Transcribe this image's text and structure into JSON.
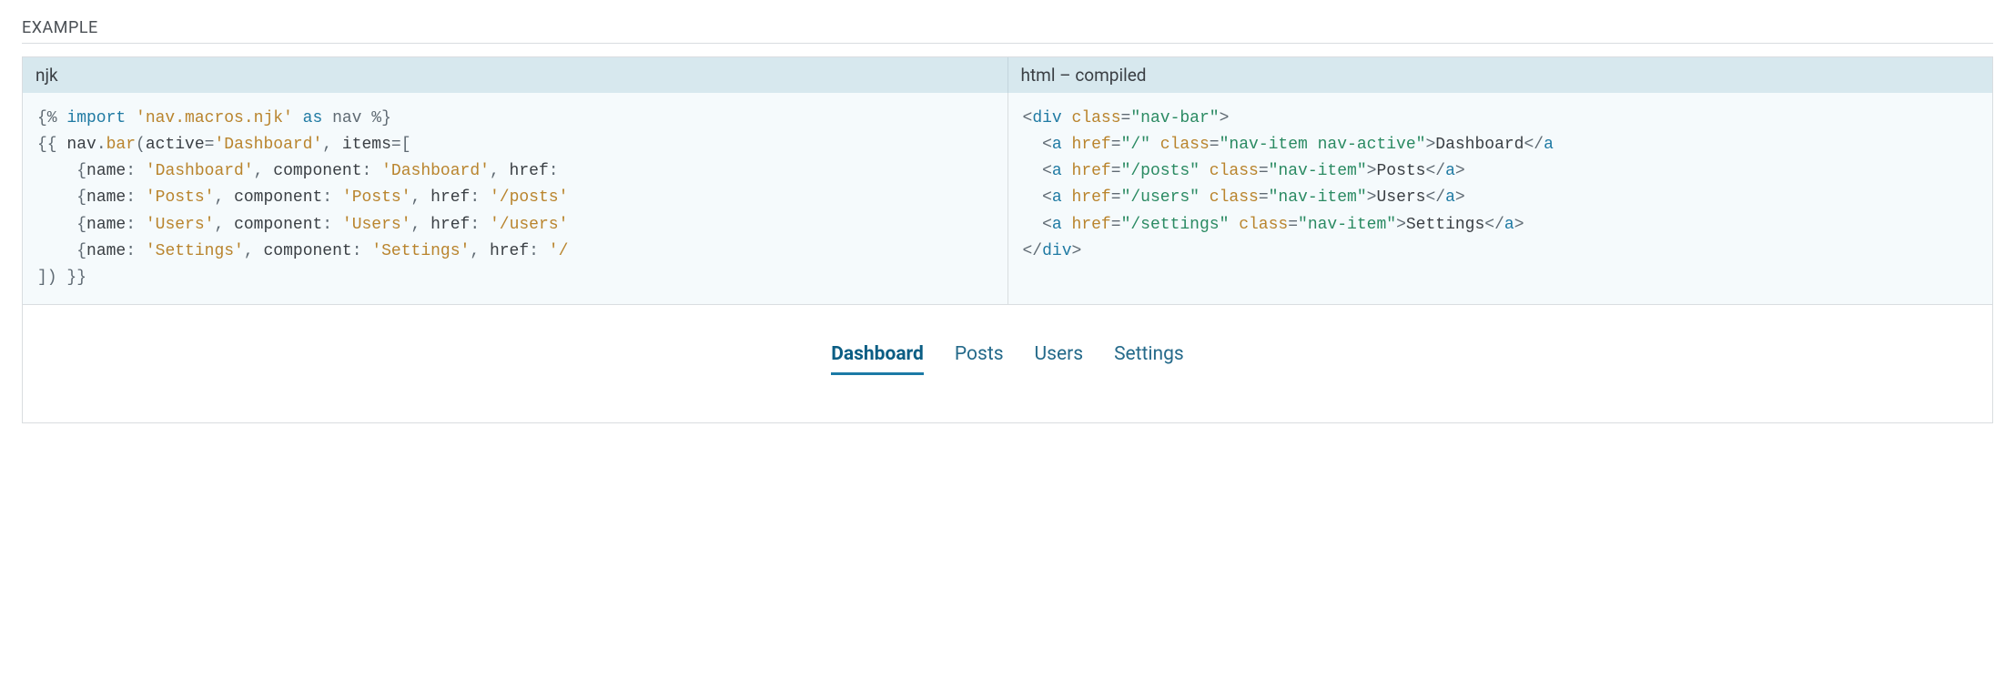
{
  "section_label": "EXAMPLE",
  "tabs": {
    "left": "njk",
    "right": "html – compiled"
  },
  "code_left_lines": [
    [
      {
        "c": "tok-delim",
        "t": "{% "
      },
      {
        "c": "tok-key",
        "t": "import"
      },
      {
        "c": "tok-delim",
        "t": " "
      },
      {
        "c": "tok-str",
        "t": "'nav.macros.njk'"
      },
      {
        "c": "tok-delim",
        "t": " "
      },
      {
        "c": "tok-key",
        "t": "as"
      },
      {
        "c": "tok-delim",
        "t": " nav %}"
      }
    ],
    [
      {
        "c": "tok-delim",
        "t": "{{ "
      },
      {
        "c": "tok-ident",
        "t": "nav"
      },
      {
        "c": "tok-delim",
        "t": "."
      },
      {
        "c": "tok-fn",
        "t": "bar"
      },
      {
        "c": "tok-delim",
        "t": "("
      },
      {
        "c": "tok-ident",
        "t": "active"
      },
      {
        "c": "tok-delim",
        "t": "="
      },
      {
        "c": "tok-str",
        "t": "'Dashboard'"
      },
      {
        "c": "tok-delim",
        "t": ", "
      },
      {
        "c": "tok-ident",
        "t": "items"
      },
      {
        "c": "tok-delim",
        "t": "=["
      }
    ],
    [
      {
        "c": "tok-delim",
        "t": "    {"
      },
      {
        "c": "tok-ident",
        "t": "name"
      },
      {
        "c": "tok-delim",
        "t": ": "
      },
      {
        "c": "tok-str",
        "t": "'Dashboard'"
      },
      {
        "c": "tok-delim",
        "t": ", "
      },
      {
        "c": "tok-ident",
        "t": "component"
      },
      {
        "c": "tok-delim",
        "t": ": "
      },
      {
        "c": "tok-str",
        "t": "'Dashboard'"
      },
      {
        "c": "tok-delim",
        "t": ", "
      },
      {
        "c": "tok-ident",
        "t": "href"
      },
      {
        "c": "tok-delim",
        "t": ": "
      }
    ],
    [
      {
        "c": "tok-delim",
        "t": "    {"
      },
      {
        "c": "tok-ident",
        "t": "name"
      },
      {
        "c": "tok-delim",
        "t": ": "
      },
      {
        "c": "tok-str",
        "t": "'Posts'"
      },
      {
        "c": "tok-delim",
        "t": ", "
      },
      {
        "c": "tok-ident",
        "t": "component"
      },
      {
        "c": "tok-delim",
        "t": ": "
      },
      {
        "c": "tok-str",
        "t": "'Posts'"
      },
      {
        "c": "tok-delim",
        "t": ", "
      },
      {
        "c": "tok-ident",
        "t": "href"
      },
      {
        "c": "tok-delim",
        "t": ": "
      },
      {
        "c": "tok-str",
        "t": "'/posts'"
      }
    ],
    [
      {
        "c": "tok-delim",
        "t": "    {"
      },
      {
        "c": "tok-ident",
        "t": "name"
      },
      {
        "c": "tok-delim",
        "t": ": "
      },
      {
        "c": "tok-str",
        "t": "'Users'"
      },
      {
        "c": "tok-delim",
        "t": ", "
      },
      {
        "c": "tok-ident",
        "t": "component"
      },
      {
        "c": "tok-delim",
        "t": ": "
      },
      {
        "c": "tok-str",
        "t": "'Users'"
      },
      {
        "c": "tok-delim",
        "t": ", "
      },
      {
        "c": "tok-ident",
        "t": "href"
      },
      {
        "c": "tok-delim",
        "t": ": "
      },
      {
        "c": "tok-str",
        "t": "'/users'"
      }
    ],
    [
      {
        "c": "tok-delim",
        "t": "    {"
      },
      {
        "c": "tok-ident",
        "t": "name"
      },
      {
        "c": "tok-delim",
        "t": ": "
      },
      {
        "c": "tok-str",
        "t": "'Settings'"
      },
      {
        "c": "tok-delim",
        "t": ", "
      },
      {
        "c": "tok-ident",
        "t": "component"
      },
      {
        "c": "tok-delim",
        "t": ": "
      },
      {
        "c": "tok-str",
        "t": "'Settings'"
      },
      {
        "c": "tok-delim",
        "t": ", "
      },
      {
        "c": "tok-ident",
        "t": "href"
      },
      {
        "c": "tok-delim",
        "t": ": "
      },
      {
        "c": "tok-str",
        "t": "'/"
      }
    ],
    [
      {
        "c": "tok-delim",
        "t": "]) }}"
      }
    ]
  ],
  "code_right_lines": [
    [
      {
        "c": "tok-punc",
        "t": "<"
      },
      {
        "c": "tok-tag",
        "t": "div"
      },
      {
        "c": "tok-punc",
        "t": " "
      },
      {
        "c": "tok-attr",
        "t": "class"
      },
      {
        "c": "tok-punc",
        "t": "="
      },
      {
        "c": "tok-attrv",
        "t": "\"nav-bar\""
      },
      {
        "c": "tok-punc",
        "t": ">"
      }
    ],
    [
      {
        "c": "tok-punc",
        "t": "  <"
      },
      {
        "c": "tok-tag",
        "t": "a"
      },
      {
        "c": "tok-punc",
        "t": " "
      },
      {
        "c": "tok-attr",
        "t": "href"
      },
      {
        "c": "tok-punc",
        "t": "="
      },
      {
        "c": "tok-attrv",
        "t": "\"/\""
      },
      {
        "c": "tok-punc",
        "t": " "
      },
      {
        "c": "tok-attr",
        "t": "class"
      },
      {
        "c": "tok-punc",
        "t": "="
      },
      {
        "c": "tok-attrv",
        "t": "\"nav-item nav-active\""
      },
      {
        "c": "tok-punc",
        "t": ">"
      },
      {
        "c": "tok-text",
        "t": "Dashboard"
      },
      {
        "c": "tok-punc",
        "t": "</"
      },
      {
        "c": "tok-tag",
        "t": "a"
      }
    ],
    [
      {
        "c": "tok-punc",
        "t": "  <"
      },
      {
        "c": "tok-tag",
        "t": "a"
      },
      {
        "c": "tok-punc",
        "t": " "
      },
      {
        "c": "tok-attr",
        "t": "href"
      },
      {
        "c": "tok-punc",
        "t": "="
      },
      {
        "c": "tok-attrv",
        "t": "\"/posts\""
      },
      {
        "c": "tok-punc",
        "t": " "
      },
      {
        "c": "tok-attr",
        "t": "class"
      },
      {
        "c": "tok-punc",
        "t": "="
      },
      {
        "c": "tok-attrv",
        "t": "\"nav-item\""
      },
      {
        "c": "tok-punc",
        "t": ">"
      },
      {
        "c": "tok-text",
        "t": "Posts"
      },
      {
        "c": "tok-punc",
        "t": "</"
      },
      {
        "c": "tok-tag",
        "t": "a"
      },
      {
        "c": "tok-punc",
        "t": ">"
      }
    ],
    [
      {
        "c": "tok-punc",
        "t": "  <"
      },
      {
        "c": "tok-tag",
        "t": "a"
      },
      {
        "c": "tok-punc",
        "t": " "
      },
      {
        "c": "tok-attr",
        "t": "href"
      },
      {
        "c": "tok-punc",
        "t": "="
      },
      {
        "c": "tok-attrv",
        "t": "\"/users\""
      },
      {
        "c": "tok-punc",
        "t": " "
      },
      {
        "c": "tok-attr",
        "t": "class"
      },
      {
        "c": "tok-punc",
        "t": "="
      },
      {
        "c": "tok-attrv",
        "t": "\"nav-item\""
      },
      {
        "c": "tok-punc",
        "t": ">"
      },
      {
        "c": "tok-text",
        "t": "Users"
      },
      {
        "c": "tok-punc",
        "t": "</"
      },
      {
        "c": "tok-tag",
        "t": "a"
      },
      {
        "c": "tok-punc",
        "t": ">"
      }
    ],
    [
      {
        "c": "tok-punc",
        "t": "  <"
      },
      {
        "c": "tok-tag",
        "t": "a"
      },
      {
        "c": "tok-punc",
        "t": " "
      },
      {
        "c": "tok-attr",
        "t": "href"
      },
      {
        "c": "tok-punc",
        "t": "="
      },
      {
        "c": "tok-attrv",
        "t": "\"/settings\""
      },
      {
        "c": "tok-punc",
        "t": " "
      },
      {
        "c": "tok-attr",
        "t": "class"
      },
      {
        "c": "tok-punc",
        "t": "="
      },
      {
        "c": "tok-attrv",
        "t": "\"nav-item\""
      },
      {
        "c": "tok-punc",
        "t": ">"
      },
      {
        "c": "tok-text",
        "t": "Settings"
      },
      {
        "c": "tok-punc",
        "t": "</"
      },
      {
        "c": "tok-tag",
        "t": "a"
      },
      {
        "c": "tok-punc",
        "t": ">"
      }
    ],
    [
      {
        "c": "tok-punc",
        "t": "</"
      },
      {
        "c": "tok-tag",
        "t": "div"
      },
      {
        "c": "tok-punc",
        "t": ">"
      }
    ]
  ],
  "nav_items": [
    {
      "label": "Dashboard",
      "active": true
    },
    {
      "label": "Posts",
      "active": false
    },
    {
      "label": "Users",
      "active": false
    },
    {
      "label": "Settings",
      "active": false
    }
  ]
}
